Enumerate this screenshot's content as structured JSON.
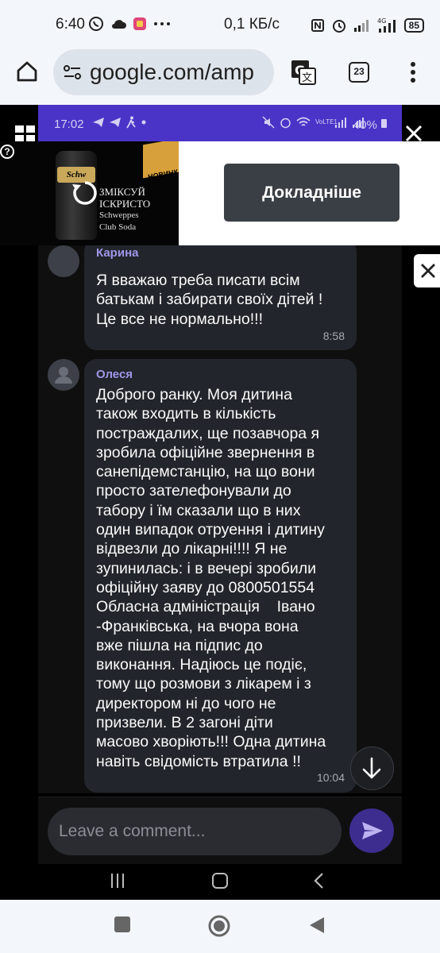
{
  "status_bar": {
    "time": "6:40",
    "net_speed": "0,1 КБ/с",
    "battery": "85"
  },
  "browser": {
    "url": "google.com/amp",
    "tab_count": "23"
  },
  "inner_status": {
    "time": "17:02",
    "battery": "40%",
    "volte": "VoLTE1"
  },
  "ad": {
    "cta_label": "Докладніше",
    "badge": "НОВИНКА",
    "can_brand": "Schw",
    "copy_line1": "ЗМІКСУЙ ІСКРИСТО",
    "copy_line2": "Schweppes",
    "copy_line3": "Club Soda",
    "help": "?"
  },
  "chat": {
    "messages": [
      {
        "sender": "Карина",
        "lines": [
          "Я вважаю треба писати всім",
          "батькам і забирати своїх дітей !",
          "Це все не нормально!!!"
        ],
        "time": "8:58"
      },
      {
        "sender": "Олеся",
        "lines": [
          "Доброго ранку. Моя дитина",
          "також входить в кількість",
          "постраждалих, ще позавчора я",
          "зробила офіційне звернення в",
          "санепідемстанцію, на що вони",
          "просто зателефонували до",
          "табору і їм сказали що в них",
          "один випадок отруення і дитину",
          "відвезли до лікарні!!!! Я не",
          "зупинилась: і в вечері зробили",
          "офіційну заяву до 0800501554",
          "Обласна адміністрація    Івано",
          "-Франківська, на вчора вона",
          "вже пішла на підпис до",
          "виконання. Надіюсь це подіє,",
          "тому що розмови з лікарем і з",
          "директором ні до чого не",
          "призвели. В 2 загоні діти",
          "масово хворіють!!! Одна дитина",
          "навіть свідомість втратила !!"
        ],
        "time": "10:04"
      }
    ]
  },
  "comment": {
    "placeholder": "Leave a comment..."
  },
  "colors": {
    "inner_status_bg": "#4a34c7",
    "bubble_bg": "#22252c",
    "sender_color": "#9f97e8",
    "send_btn": "#3d2d8f"
  }
}
